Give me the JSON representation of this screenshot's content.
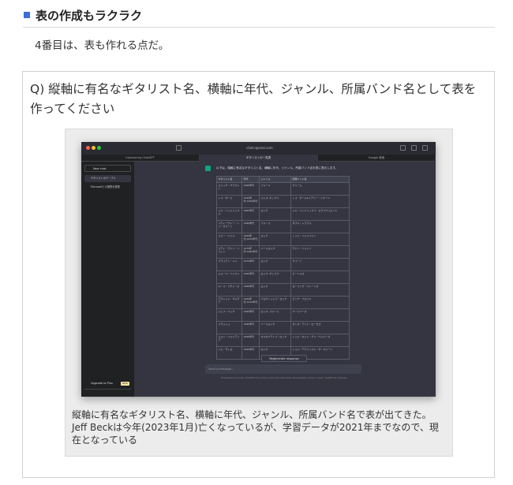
{
  "section": {
    "title": "表の作成もラクラク",
    "marker_color": "#3b6fd8"
  },
  "lead": "4番目は、表も作れる点だ。",
  "question": "Q) 縦軸に有名なギタリスト名、横軸に年代、ジャンル、所属バンド名として表を作ってください",
  "screenshot": {
    "url": "chat.openai.com",
    "tabs": [
      "Introducing ChatGPT",
      "ギタリストの一覧表",
      "Google 検索"
    ],
    "sidebar": {
      "new_chat": "New chat",
      "items": [
        "ギタリストのテーブル",
        "Microsoftとの提携を発表"
      ],
      "upgrade": "Upgrade to Plus",
      "badge": "NEW"
    },
    "prompt": "以下は、縦軸に有名なギタリスト名、横軸に年代、ジャンル、所属バンド名を表に表示します。",
    "table": {
      "headers": [
        "ギタリスト名",
        "年代",
        "ジャンル",
        "所属バンド名"
      ],
      "rows": [
        [
          "エリック・クラプトン",
          "1960年代",
          "ブルース",
          "クリーム"
        ],
        [
          "レス・ポール",
          "1940年代-1950年代",
          "ジャズ, ポップス",
          "レス・ポール&メアリー・フォード"
        ],
        [
          "ジミ・ヘンドリックス",
          "1960年代",
          "ロック",
          "ジミ・ヘンドリックス・エクスペリエンス"
        ],
        [
          "スティーヴィー・レイ・ヴォーン",
          "1980年代",
          "ブルース",
          "ダブル・トラブル"
        ],
        [
          "ジミー・ペイジ",
          "1960年代-1970年代",
          "ロック",
          "レッド・ツェッペリン"
        ],
        [
          "エディ・ヴァン・ヘイレン",
          "1970年代-1980年代",
          "ハードロック",
          "ヴァン・ヘイレン"
        ],
        [
          "ブライアン・メイ",
          "1970年代",
          "ロック",
          "クイーン"
        ],
        [
          "ジョージ・ハリスン",
          "1960年代",
          "ロック, ポップス",
          "ビートルズ"
        ],
        [
          "キース・リチャーズ",
          "1960年代",
          "ロック",
          "ローリング・ストーンズ"
        ],
        [
          "デヴィッド・ギルモア",
          "1960年代-1970年代",
          "プログレッシブ・ロック",
          "ピンク・フロイド"
        ],
        [
          "ジェフ・ベック",
          "1960年代",
          "ロック, ブルース",
          "ヤードバーズ"
        ],
        [
          "スラッシュ",
          "1980年代",
          "ハードロック",
          "ガンズ・アンド・ローゼズ"
        ],
        [
          "ジョン・フルシアンテ",
          "1990年代",
          "オルタナティブ・ロック",
          "レッド・ホット・チリ・ペッパーズ"
        ],
        [
          "トム・モレロ",
          "1990年代",
          "ロック",
          "レイジ・アゲインスト・ザ・マシーン"
        ]
      ]
    },
    "regenerate": "Regenerate response",
    "input_placeholder": "Send a message...",
    "footer": "Free Research Preview. ChatGPT may produce inaccurate information about people, places, or facts. ChatGPT Jan 9 Version"
  },
  "caption_lines": [
    "縦軸に有名なギタリスト名、横軸に年代、ジャンル、所属バンド名で表が出てきた。",
    "Jeff Beckは今年(2023年1月)亡くなっているが、学習データが2021年までなので、現在となっている"
  ]
}
